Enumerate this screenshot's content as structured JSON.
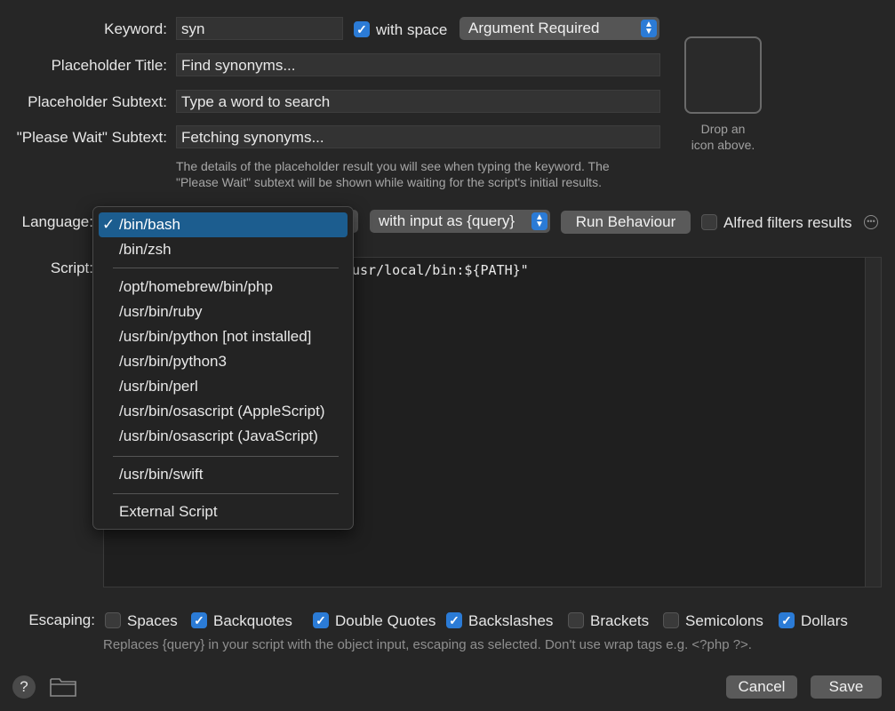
{
  "form": {
    "keyword_label": "Keyword:",
    "keyword_value": "syn",
    "with_space_label": "with space",
    "argument_popup": "Argument Required",
    "placeholder_title_label": "Placeholder Title:",
    "placeholder_title_value": "Find synonyms...",
    "placeholder_subtext_label": "Placeholder Subtext:",
    "placeholder_subtext_value": "Type a word to search",
    "please_wait_label": "\"Please Wait\" Subtext:",
    "please_wait_value": "Fetching synonyms...",
    "hint_line1": "The details of the placeholder result you will see when typing the keyword. The",
    "hint_line2": "\"Please Wait\" subtext will be shown while waiting for the script's initial results."
  },
  "icon_well": {
    "caption_line1": "Drop an",
    "caption_line2": "icon above."
  },
  "script_row": {
    "language_label": "Language:",
    "input_popup": "with input as {query}",
    "run_behaviour_button": "Run Behaviour",
    "alfred_filters_label": "Alfred filters results",
    "script_label": "Script:",
    "script_visible_text": "usr/local/bin:${PATH}\""
  },
  "language_menu": {
    "check": "✓",
    "group1": [
      "/bin/bash",
      "/bin/zsh"
    ],
    "group2": [
      "/opt/homebrew/bin/php",
      "/usr/bin/ruby",
      "/usr/bin/python [not installed]",
      "/usr/bin/python3",
      "/usr/bin/perl",
      "/usr/bin/osascript (AppleScript)",
      "/usr/bin/osascript (JavaScript)"
    ],
    "group3": [
      "/usr/bin/swift"
    ],
    "group4": [
      "External Script"
    ],
    "selected": "/bin/bash"
  },
  "escaping": {
    "label": "Escaping:",
    "options": [
      {
        "label": "Spaces",
        "checked": false
      },
      {
        "label": "Backquotes",
        "checked": true
      },
      {
        "label": "Double Quotes",
        "checked": true
      },
      {
        "label": "Backslashes",
        "checked": true
      },
      {
        "label": "Brackets",
        "checked": false
      },
      {
        "label": "Semicolons",
        "checked": false
      },
      {
        "label": "Dollars",
        "checked": true
      }
    ],
    "hint": "Replaces {query} in your script with the object input, escaping as selected. Don't use wrap tags e.g. <?php ?>."
  },
  "footer": {
    "help_label": "?",
    "cancel_button": "Cancel",
    "save_button": "Save"
  },
  "colors": {
    "background": "#262626",
    "accent": "#2b7bd6",
    "menu_selected": "#1c5d8f"
  },
  "icons": {
    "help": "help-icon",
    "folder": "folder-icon",
    "more": "ellipsis-circle-icon",
    "stepper": "chevron-updown-icon",
    "check": "checkmark-icon"
  }
}
